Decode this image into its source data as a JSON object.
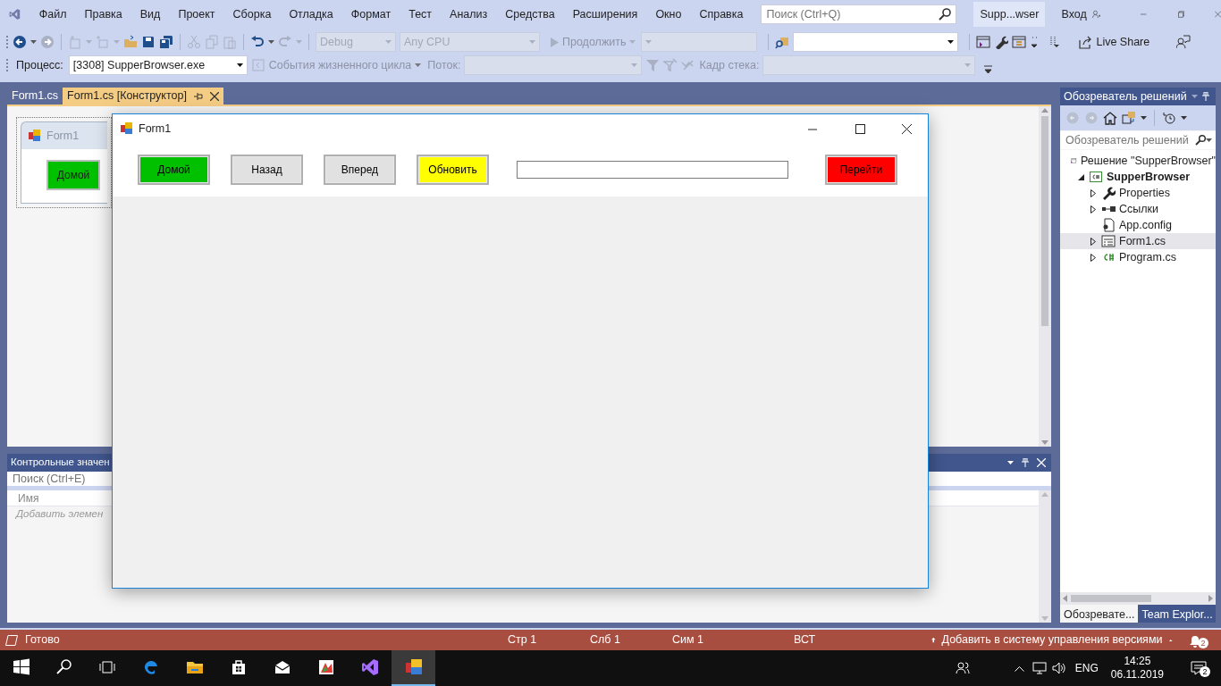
{
  "menu": [
    "Файл",
    "Правка",
    "Вид",
    "Проект",
    "Сборка",
    "Отладка",
    "Формат",
    "Тест",
    "Анализ",
    "Средства",
    "Расширения",
    "Окно",
    "Справка"
  ],
  "search": {
    "placeholder": "Поиск (Ctrl+Q)"
  },
  "solution_badge": "Supp...wser",
  "sign_in": "Вход",
  "toolbar": {
    "config": {
      "value": "Debug",
      "disabled": true
    },
    "platform": {
      "value": "Any CPU",
      "disabled": true
    },
    "continue": {
      "label": "Продолжить",
      "disabled": true
    },
    "live_share": "Live Share"
  },
  "debug_location": {
    "process_label": "Процесс:",
    "process": "[3308] SupperBrowser.exe",
    "lifecycle": "События жизненного цикла",
    "thread_label": "Поток:",
    "stack_label": "Кадр стека:"
  },
  "doc_tabs": [
    {
      "label": "Form1.cs",
      "selected": false
    },
    {
      "label": "Form1.cs [Конструктор]",
      "selected": true
    }
  ],
  "designer": {
    "form_title": "Form1",
    "button": "Домой"
  },
  "watch_panel": {
    "title": "Контрольные значен",
    "search_placeholder": "Поиск (Ctrl+E)",
    "column": "Имя",
    "add_hint": "Добавить элемен"
  },
  "solution_explorer": {
    "title": "Обозреватель решений",
    "search_placeholder": "Обозреватель решений",
    "tree": [
      {
        "label": "Решение \"SupperBrowser\"",
        "kind": "solution",
        "selected": false,
        "children": [
          {
            "label": "SupperBrowser",
            "kind": "project",
            "selected": false,
            "expanded": true,
            "children": [
              {
                "label": "Properties",
                "kind": "properties",
                "selected": false,
                "expanded": false
              },
              {
                "label": "Ссылки",
                "kind": "references",
                "selected": false,
                "expanded": false
              },
              {
                "label": "App.config",
                "kind": "config",
                "selected": false
              },
              {
                "label": "Form1.cs",
                "kind": "form",
                "selected": true,
                "expanded": false
              },
              {
                "label": "Program.cs",
                "kind": "csharp",
                "selected": false,
                "expanded": false
              }
            ]
          }
        ]
      }
    ],
    "tabs": [
      {
        "label": "Обозревате...",
        "selected": true
      },
      {
        "label": "Team Explor...",
        "selected": false
      }
    ]
  },
  "form_window": {
    "title": "Form1",
    "controls": [
      {
        "kind": "button",
        "label": "Домой",
        "color": "#00c000"
      },
      {
        "kind": "button",
        "label": "Назад",
        "color": "#e1e1e1"
      },
      {
        "kind": "button",
        "label": "Вперед",
        "color": "#e1e1e1"
      },
      {
        "kind": "button",
        "label": "Обновить",
        "color": "#ffff00"
      },
      {
        "kind": "textbox"
      },
      {
        "kind": "button",
        "label": "Перейти",
        "color": "#ff0000"
      }
    ]
  },
  "status_bar": {
    "state": "Готово",
    "line": "Стр 1",
    "column": "Слб 1",
    "char": "Сим 1",
    "mode": "ВСТ",
    "source_control": "Добавить в систему управления версиями",
    "notifications": "2"
  },
  "taskbar": {
    "apps": [
      {
        "kind": "edge",
        "selected": false
      },
      {
        "kind": "explorer",
        "selected": false
      },
      {
        "kind": "store",
        "selected": false
      },
      {
        "kind": "mail",
        "selected": false
      },
      {
        "kind": "office",
        "selected": false
      },
      {
        "kind": "vs",
        "selected": false
      },
      {
        "kind": "form",
        "selected": true
      }
    ],
    "language": "ENG",
    "time": "14:25",
    "date": "06.11.2019",
    "notifications": "2"
  }
}
